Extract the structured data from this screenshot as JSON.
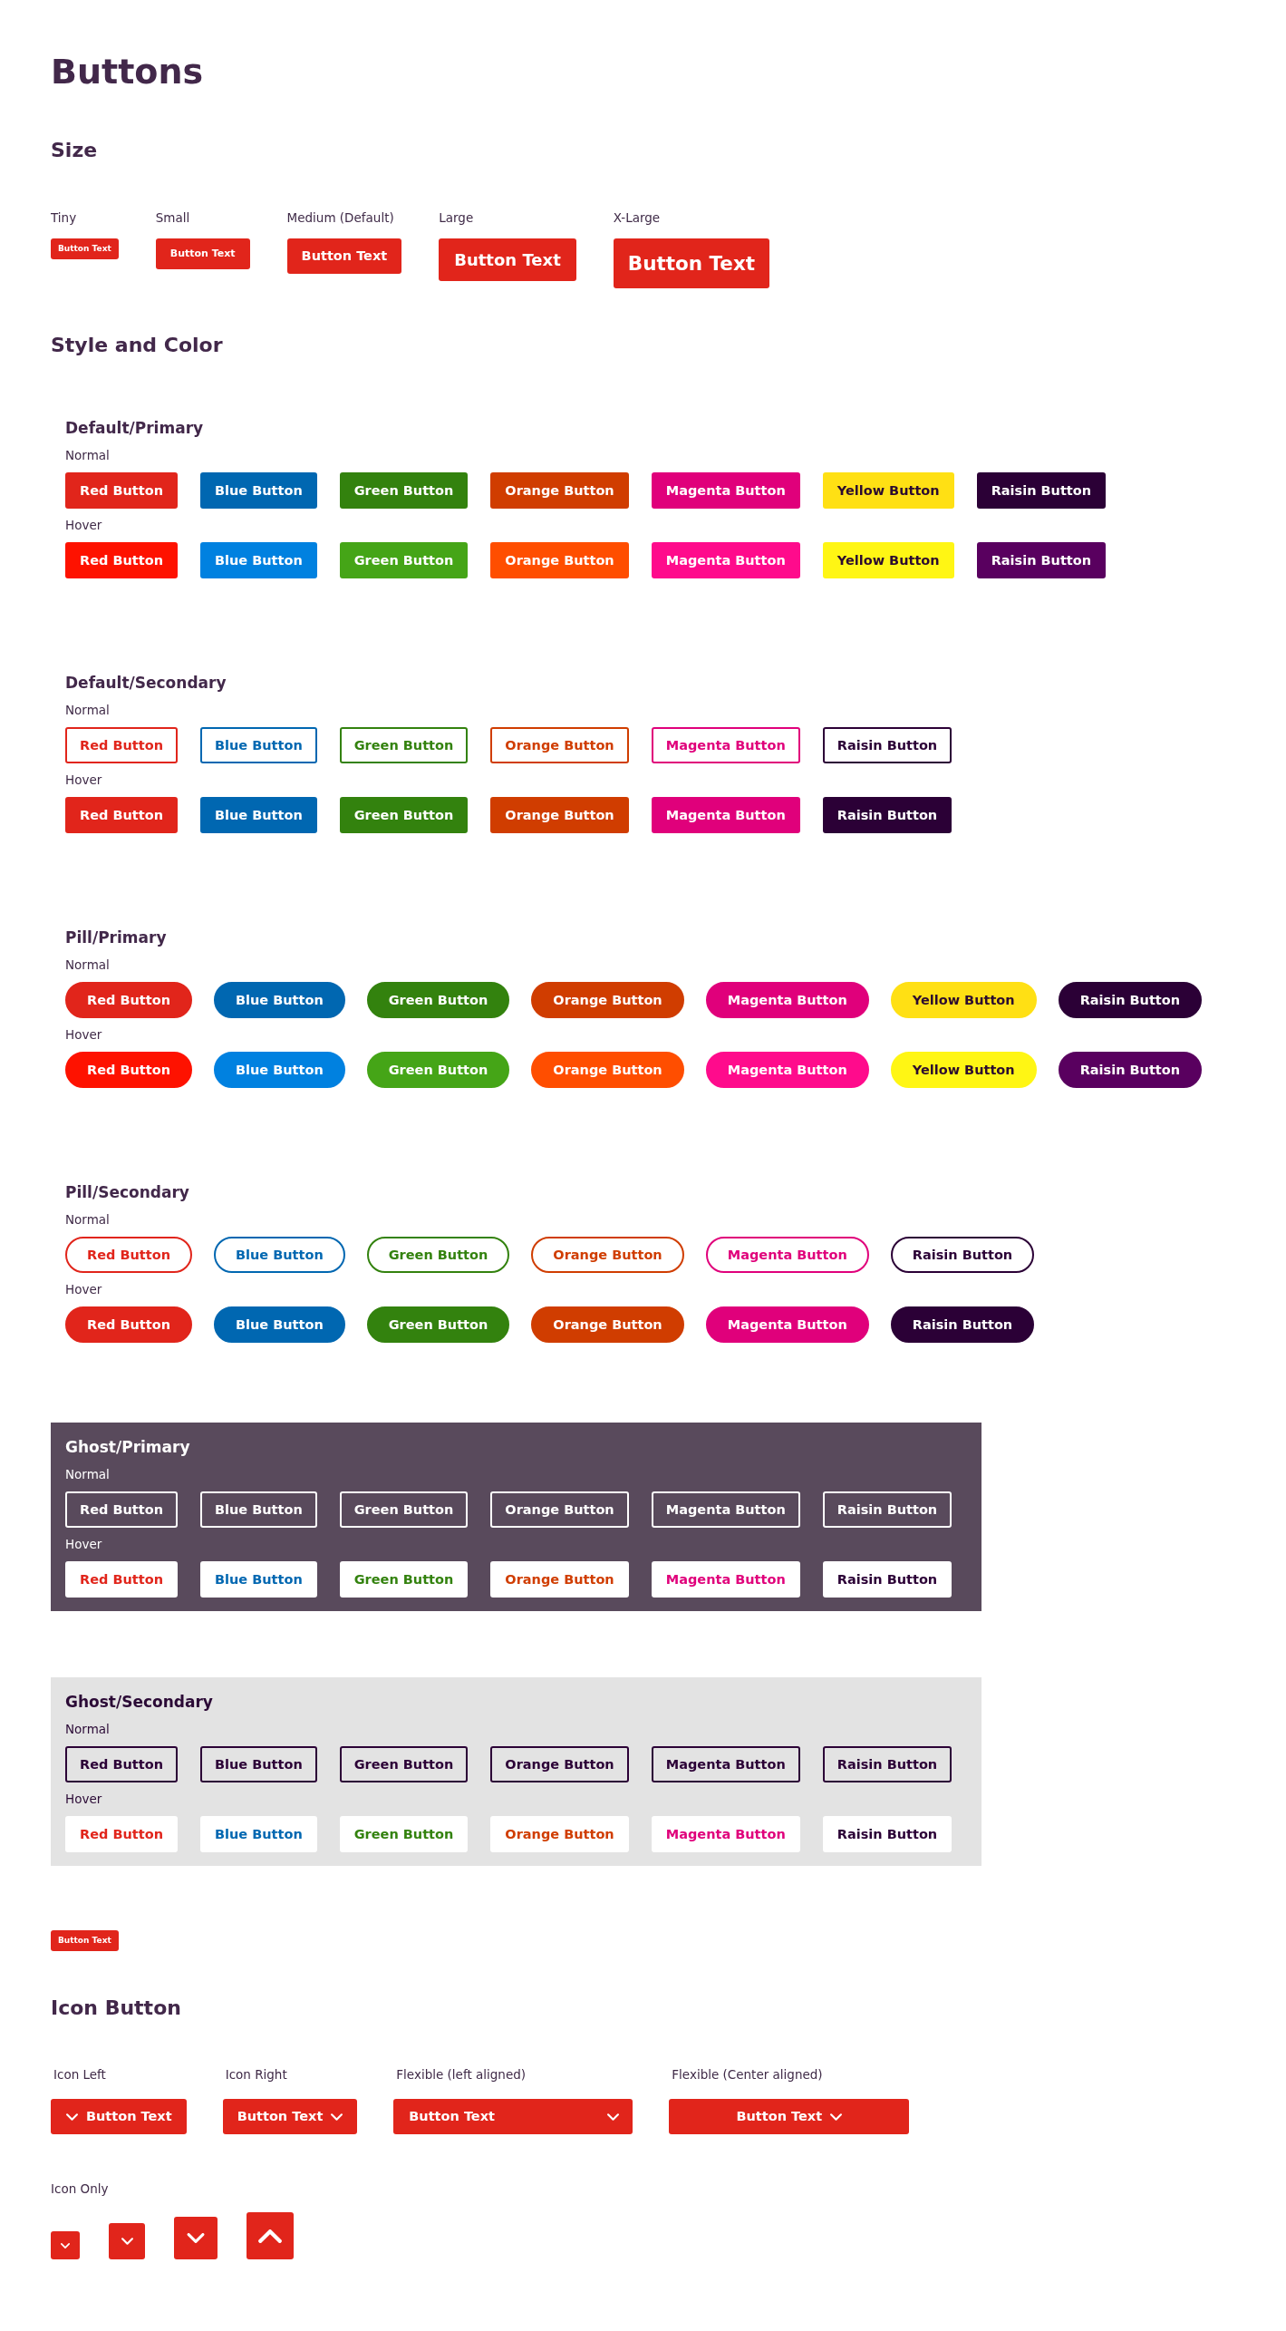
{
  "page": {
    "title": "Buttons"
  },
  "size_section": {
    "heading": "Size",
    "items": [
      {
        "label": "Tiny",
        "kind": "tiny",
        "button": "Button Text"
      },
      {
        "label": "Small",
        "kind": "small",
        "button": "Button Text"
      },
      {
        "label": "Medium (Default)",
        "kind": "medium",
        "button": "Button Text"
      },
      {
        "label": "Large",
        "kind": "large",
        "button": "Button Text"
      },
      {
        "label": "X-Large",
        "kind": "xlarge",
        "button": "Button Text"
      }
    ]
  },
  "style_section": {
    "heading": "Style and Color",
    "groups": [
      {
        "title": "Default/Primary",
        "kind": "block",
        "states": [
          {
            "label": "Normal",
            "kind": "solid",
            "buttons": [
              {
                "label": "Red Button",
                "color": "#e1251b"
              },
              {
                "label": "Blue Button",
                "color": "#0067b1"
              },
              {
                "label": "Green Button",
                "color": "#33820e"
              },
              {
                "label": "Orange Button",
                "color": "#d03d00"
              },
              {
                "label": "Magenta Button",
                "color": "#e0007b"
              },
              {
                "label": "Yellow Button",
                "color": "#ffe014"
              },
              {
                "label": "Raisin Button",
                "color": "#2b0036"
              }
            ]
          },
          {
            "label": "Hover",
            "kind": "solid",
            "buttons": [
              {
                "label": "Red Button",
                "color": "#fe1200"
              },
              {
                "label": "Blue Button",
                "color": "#0081e0"
              },
              {
                "label": "Green Button",
                "color": "#45a517"
              },
              {
                "label": "Orange Button",
                "color": "#ff4e00"
              },
              {
                "label": "Magenta Button",
                "color": "#ff0b8c"
              },
              {
                "label": "Yellow Button",
                "color": "#fff614"
              },
              {
                "label": "Raisin Button",
                "color": "#59005f"
              }
            ]
          }
        ]
      },
      {
        "title": "Default/Secondary",
        "kind": "block",
        "states": [
          {
            "label": "Normal",
            "kind": "outline",
            "buttons": [
              {
                "label": "Red Button",
                "color": "#e1251b"
              },
              {
                "label": "Blue Button",
                "color": "#0067b1"
              },
              {
                "label": "Green Button",
                "color": "#33820e"
              },
              {
                "label": "Orange Button",
                "color": "#d03d00"
              },
              {
                "label": "Magenta Button",
                "color": "#e0007b"
              },
              {
                "label": "Raisin Button",
                "color": "#2b0036"
              }
            ]
          },
          {
            "label": "Hover",
            "kind": "solid",
            "buttons": [
              {
                "label": "Red Button",
                "color": "#e1251b"
              },
              {
                "label": "Blue Button",
                "color": "#0067b1"
              },
              {
                "label": "Green Button",
                "color": "#33820e"
              },
              {
                "label": "Orange Button",
                "color": "#d03d00"
              },
              {
                "label": "Magenta Button",
                "color": "#e0007b"
              },
              {
                "label": "Raisin Button",
                "color": "#2b0036"
              }
            ]
          }
        ]
      },
      {
        "title": "Pill/Primary",
        "kind": "pill",
        "states": [
          {
            "label": "Normal",
            "kind": "solid",
            "buttons": [
              {
                "label": "Red Button",
                "color": "#e1251b"
              },
              {
                "label": "Blue Button",
                "color": "#0067b1"
              },
              {
                "label": "Green Button",
                "color": "#33820e"
              },
              {
                "label": "Orange Button",
                "color": "#d03d00"
              },
              {
                "label": "Magenta Button",
                "color": "#e0007b"
              },
              {
                "label": "Yellow Button",
                "color": "#ffe014"
              },
              {
                "label": "Raisin Button",
                "color": "#2b0036"
              }
            ]
          },
          {
            "label": "Hover",
            "kind": "solid",
            "buttons": [
              {
                "label": "Red Button",
                "color": "#fe1200"
              },
              {
                "label": "Blue Button",
                "color": "#0081e0"
              },
              {
                "label": "Green Button",
                "color": "#45a517"
              },
              {
                "label": "Orange Button",
                "color": "#ff4e00"
              },
              {
                "label": "Magenta Button",
                "color": "#ff0b8c"
              },
              {
                "label": "Yellow Button",
                "color": "#fff614"
              },
              {
                "label": "Raisin Button",
                "color": "#59005f"
              }
            ]
          }
        ]
      },
      {
        "title": "Pill/Secondary",
        "kind": "pill",
        "states": [
          {
            "label": "Normal",
            "kind": "outline",
            "buttons": [
              {
                "label": "Red Button",
                "color": "#e1251b"
              },
              {
                "label": "Blue Button",
                "color": "#0067b1"
              },
              {
                "label": "Green Button",
                "color": "#33820e"
              },
              {
                "label": "Orange Button",
                "color": "#d03d00"
              },
              {
                "label": "Magenta Button",
                "color": "#e0007b"
              },
              {
                "label": "Raisin Button",
                "color": "#2b0036"
              }
            ]
          },
          {
            "label": "Hover",
            "kind": "solid",
            "buttons": [
              {
                "label": "Red Button",
                "color": "#e1251b"
              },
              {
                "label": "Blue Button",
                "color": "#0067b1"
              },
              {
                "label": "Green Button",
                "color": "#33820e"
              },
              {
                "label": "Orange Button",
                "color": "#d03d00"
              },
              {
                "label": "Magenta Button",
                "color": "#e0007b"
              },
              {
                "label": "Raisin Button",
                "color": "#2b0036"
              }
            ]
          }
        ]
      },
      {
        "title": "Ghost/Primary",
        "kind": "darkpanel",
        "states": [
          {
            "label": "Normal",
            "kind": "ghostline",
            "buttons": [
              {
                "label": "Red Button"
              },
              {
                "label": "Blue Button"
              },
              {
                "label": "Green Button"
              },
              {
                "label": "Orange Button"
              },
              {
                "label": "Magenta Button"
              },
              {
                "label": "Raisin Button"
              }
            ]
          },
          {
            "label": "Hover",
            "kind": "plain",
            "buttons": [
              {
                "label": "Red Button",
                "color": "#e1251b"
              },
              {
                "label": "Blue Button",
                "color": "#0067b1"
              },
              {
                "label": "Green Button",
                "color": "#33820e"
              },
              {
                "label": "Orange Button",
                "color": "#d03d00"
              },
              {
                "label": "Magenta Button",
                "color": "#e0007b"
              },
              {
                "label": "Raisin Button",
                "color": "#2b0036"
              }
            ]
          }
        ]
      },
      {
        "title": "Ghost/Secondary",
        "kind": "lightpanel",
        "states": [
          {
            "label": "Normal",
            "kind": "darkline",
            "buttons": [
              {
                "label": "Red Button"
              },
              {
                "label": "Blue Button"
              },
              {
                "label": "Green Button"
              },
              {
                "label": "Orange Button"
              },
              {
                "label": "Magenta Button"
              },
              {
                "label": "Raisin Button"
              }
            ]
          },
          {
            "label": "Hover",
            "kind": "plain",
            "buttons": [
              {
                "label": "Red Button",
                "color": "#e1251b"
              },
              {
                "label": "Blue Button",
                "color": "#0067b1"
              },
              {
                "label": "Green Button",
                "color": "#33820e"
              },
              {
                "label": "Orange Button",
                "color": "#d03d00"
              },
              {
                "label": "Magenta Button",
                "color": "#e0007b"
              },
              {
                "label": "Raisin Button",
                "color": "#2b0036"
              }
            ]
          }
        ]
      }
    ]
  },
  "standalone_button": {
    "label": "Button Text",
    "kind": "tiny"
  },
  "icon_section": {
    "heading": "Icon Button",
    "variants": [
      {
        "label": "Icon Left",
        "kind": "leading",
        "button": "Button Text"
      },
      {
        "label": "Icon Right",
        "kind": "trailing",
        "button": "Button Text"
      },
      {
        "label": "Flexible (left aligned)",
        "kind": "spread",
        "button": "Button Text"
      },
      {
        "label": "Flexible (Center aligned)",
        "kind": "centered",
        "button": "Button Text"
      }
    ],
    "icon_only": {
      "label": "Icon Only",
      "buttons": [
        {
          "kind": "tiny",
          "expanded": false
        },
        {
          "kind": "small",
          "expanded": false
        },
        {
          "kind": "medium",
          "expanded": false
        },
        {
          "kind": "large",
          "expanded": true
        }
      ]
    }
  }
}
